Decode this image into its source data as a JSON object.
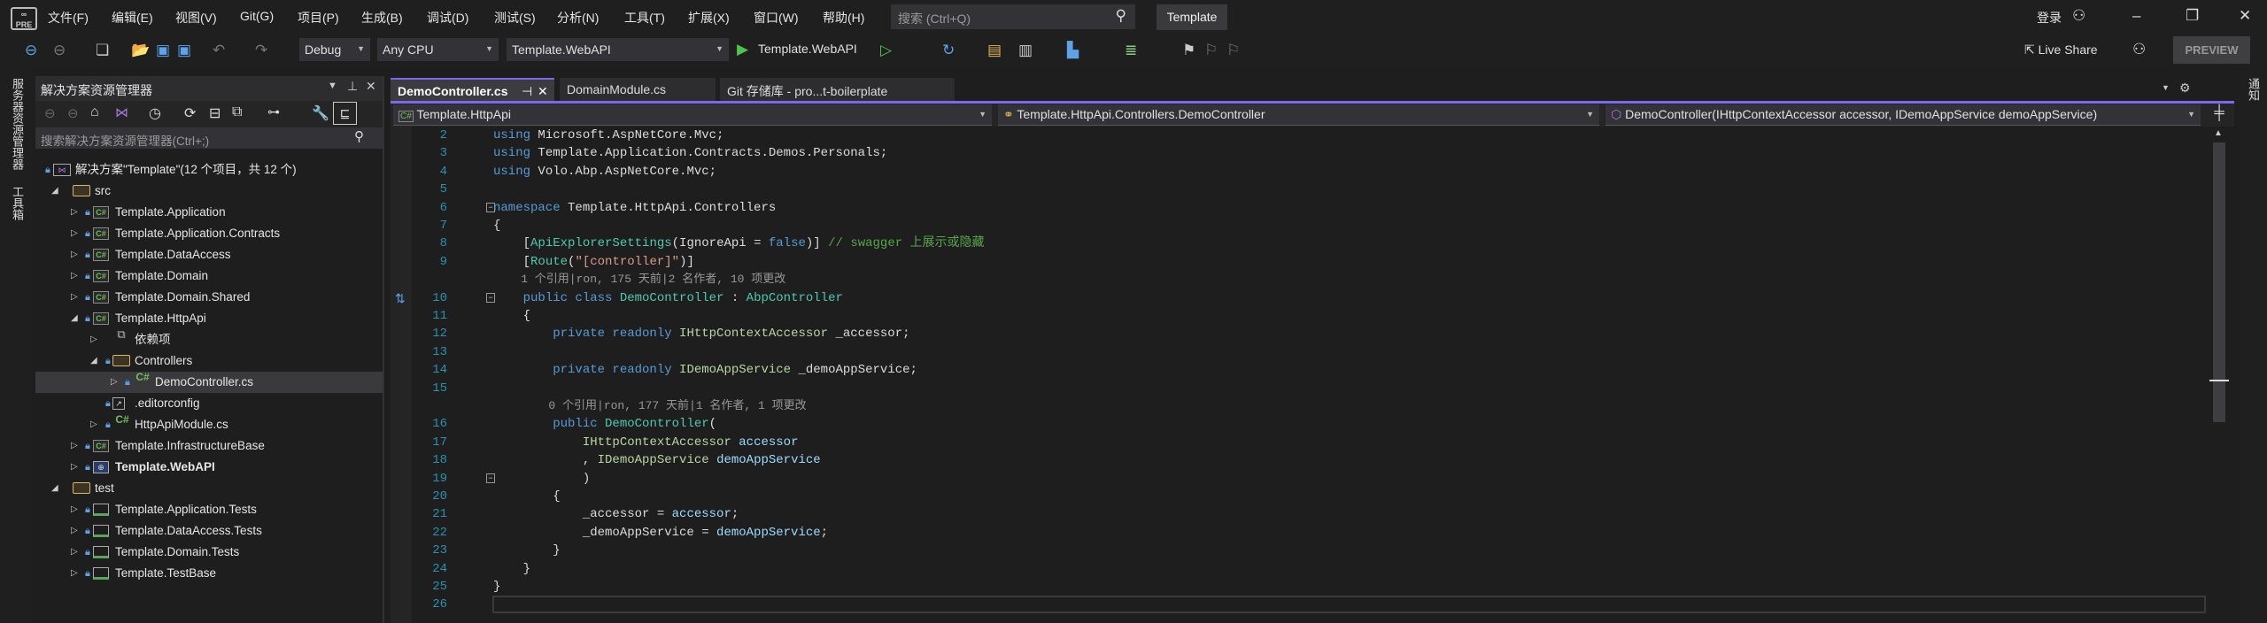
{
  "menu": {
    "logo_text": "PRE",
    "items": [
      "文件(F)",
      "编辑(E)",
      "视图(V)",
      "Git(G)",
      "项目(P)",
      "生成(B)",
      "调试(D)",
      "测试(S)",
      "分析(N)",
      "工具(T)",
      "扩展(X)",
      "窗口(W)",
      "帮助(H)"
    ],
    "search_placeholder": "搜索 (Ctrl+Q)",
    "title_badge": "Template",
    "signin": "登录"
  },
  "toolbar": {
    "config": "Debug",
    "platform": "Any CPU",
    "startup_project": "Template.WebAPI",
    "run_label": "Template.WebAPI",
    "live_share": "Live Share",
    "preview": "PREVIEW"
  },
  "left_strip": [
    "服务器资源管理器",
    "工具箱"
  ],
  "right_strip": [
    "通知"
  ],
  "solution_explorer": {
    "title": "解决方案资源管理器",
    "search_placeholder": "搜索解决方案资源管理器(Ctrl+;)",
    "items": [
      {
        "label": "解决方案\"Template\"(12 个项目，共 12 个)",
        "level": 0,
        "icon": "solution",
        "expander": "none",
        "lock": true
      },
      {
        "label": "src",
        "level": 1,
        "icon": "folder",
        "expander": "expanded",
        "lock": false
      },
      {
        "label": "Template.Application",
        "level": 2,
        "icon": "csproj",
        "expander": "collapsed",
        "lock": true
      },
      {
        "label": "Template.Application.Contracts",
        "level": 2,
        "icon": "csproj",
        "expander": "collapsed",
        "lock": true
      },
      {
        "label": "Template.DataAccess",
        "level": 2,
        "icon": "csproj",
        "expander": "collapsed",
        "lock": true
      },
      {
        "label": "Template.Domain",
        "level": 2,
        "icon": "csproj",
        "expander": "collapsed",
        "lock": true
      },
      {
        "label": "Template.Domain.Shared",
        "level": 2,
        "icon": "csproj",
        "expander": "collapsed",
        "lock": true
      },
      {
        "label": "Template.HttpApi",
        "level": 2,
        "icon": "csproj",
        "expander": "expanded",
        "lock": true
      },
      {
        "label": "依赖项",
        "level": 3,
        "icon": "dependencies",
        "expander": "collapsed",
        "lock": false
      },
      {
        "label": "Controllers",
        "level": 3,
        "icon": "folder",
        "expander": "expanded",
        "lock": true
      },
      {
        "label": "DemoController.cs",
        "level": 4,
        "icon": "csfile",
        "expander": "collapsed",
        "lock": true,
        "selected": true
      },
      {
        "label": ".editorconfig",
        "level": 3,
        "icon": "file",
        "expander": "none",
        "lock": true
      },
      {
        "label": "HttpApiModule.cs",
        "level": 3,
        "icon": "csfile",
        "expander": "collapsed",
        "lock": true
      },
      {
        "label": "Template.InfrastructureBase",
        "level": 2,
        "icon": "csproj",
        "expander": "collapsed",
        "lock": true
      },
      {
        "label": "Template.WebAPI",
        "level": 2,
        "icon": "webproj",
        "expander": "collapsed",
        "lock": true,
        "bold": true
      },
      {
        "label": "test",
        "level": 1,
        "icon": "folder",
        "expander": "expanded",
        "lock": false
      },
      {
        "label": "Template.Application.Tests",
        "level": 2,
        "icon": "testproj",
        "expander": "collapsed",
        "lock": true
      },
      {
        "label": "Template.DataAccess.Tests",
        "level": 2,
        "icon": "testproj",
        "expander": "collapsed",
        "lock": true
      },
      {
        "label": "Template.Domain.Tests",
        "level": 2,
        "icon": "testproj",
        "expander": "collapsed",
        "lock": true
      },
      {
        "label": "Template.TestBase",
        "level": 2,
        "icon": "testproj",
        "expander": "collapsed",
        "lock": true
      }
    ]
  },
  "editor": {
    "tabs": [
      {
        "label": "DemoController.cs",
        "active": true
      },
      {
        "label": "DomainModule.cs",
        "active": false
      },
      {
        "label": "Git 存储库 - pro...t-boilerplate",
        "active": false
      }
    ],
    "nav": {
      "project": "Template.HttpApi",
      "type": "Template.HttpApi.Controllers.DemoController",
      "member": "DemoController(IHttpContextAccessor accessor, IDemoAppService demoAppService)"
    },
    "lines": [
      {
        "n": "2",
        "tokens": [
          {
            "t": "using",
            "c": "kw"
          },
          {
            "t": " Microsoft.AspNetCore.Mvc;",
            "c": "tx"
          }
        ]
      },
      {
        "n": "3",
        "tokens": [
          {
            "t": "using",
            "c": "kw"
          },
          {
            "t": " Template.Application.Contracts.Demos.Personals;",
            "c": "tx"
          }
        ]
      },
      {
        "n": "4",
        "tokens": [
          {
            "t": "using",
            "c": "kw"
          },
          {
            "t": " Volo.Abp.AspNetCore.Mvc;",
            "c": "tx"
          }
        ]
      },
      {
        "n": "5",
        "tokens": []
      },
      {
        "n": "6",
        "fold": true,
        "tokens": [
          {
            "t": "namespace",
            "c": "kw"
          },
          {
            "t": " Template.HttpApi.Controllers",
            "c": "tx"
          }
        ]
      },
      {
        "n": "7",
        "tokens": [
          {
            "t": "{",
            "c": "tx"
          }
        ]
      },
      {
        "n": "8",
        "tokens": [
          {
            "t": "    [",
            "c": "tx"
          },
          {
            "t": "ApiExplorerSettings",
            "c": "ty"
          },
          {
            "t": "(IgnoreApi = ",
            "c": "tx"
          },
          {
            "t": "false",
            "c": "kw"
          },
          {
            "t": ")] ",
            "c": "tx"
          },
          {
            "t": "// swagger 上展示或隐藏",
            "c": "cm"
          }
        ]
      },
      {
        "n": "9",
        "tokens": [
          {
            "t": "    [",
            "c": "tx"
          },
          {
            "t": "Route",
            "c": "ty"
          },
          {
            "t": "(",
            "c": "tx"
          },
          {
            "t": "\"[controller]\"",
            "c": "st"
          },
          {
            "t": ")]",
            "c": "tx"
          }
        ]
      },
      {
        "lens": "    1 个引用|ron, 175 天前|2 名作者, 10 项更改"
      },
      {
        "n": "10",
        "fold": true,
        "tokens": [
          {
            "t": "    ",
            "c": "tx"
          },
          {
            "t": "public class ",
            "c": "kw"
          },
          {
            "t": "DemoController",
            "c": "ty"
          },
          {
            "t": " : ",
            "c": "tx"
          },
          {
            "t": "AbpController",
            "c": "ty"
          }
        ]
      },
      {
        "n": "11",
        "tokens": [
          {
            "t": "    {",
            "c": "tx"
          }
        ]
      },
      {
        "n": "12",
        "tokens": [
          {
            "t": "        ",
            "c": "tx"
          },
          {
            "t": "private readonly ",
            "c": "kw"
          },
          {
            "t": "IHttpContextAccessor",
            "c": "if"
          },
          {
            "t": " _accessor;",
            "c": "tx"
          }
        ]
      },
      {
        "n": "13",
        "tokens": []
      },
      {
        "n": "14",
        "tokens": [
          {
            "t": "        ",
            "c": "tx"
          },
          {
            "t": "private readonly ",
            "c": "kw"
          },
          {
            "t": "IDemoAppService",
            "c": "if"
          },
          {
            "t": " _demoAppService;",
            "c": "tx"
          }
        ]
      },
      {
        "n": "15",
        "tokens": []
      },
      {
        "lens": "        0 个引用|ron, 177 天前|1 名作者, 1 项更改"
      },
      {
        "n": "16",
        "tokens": [
          {
            "t": "        ",
            "c": "tx"
          },
          {
            "t": "public ",
            "c": "kw"
          },
          {
            "t": "DemoController",
            "c": "ty"
          },
          {
            "t": "(",
            "c": "tx"
          }
        ]
      },
      {
        "n": "17",
        "tokens": [
          {
            "t": "            ",
            "c": "tx"
          },
          {
            "t": "IHttpContextAccessor",
            "c": "if"
          },
          {
            "t": " ",
            "c": "tx"
          },
          {
            "t": "accessor",
            "c": "pa"
          }
        ]
      },
      {
        "n": "18",
        "tokens": [
          {
            "t": "            , ",
            "c": "tx"
          },
          {
            "t": "IDemoAppService",
            "c": "if"
          },
          {
            "t": " ",
            "c": "tx"
          },
          {
            "t": "demoAppService",
            "c": "pa"
          }
        ]
      },
      {
        "n": "19",
        "fold": true,
        "tokens": [
          {
            "t": "            )",
            "c": "tx"
          }
        ]
      },
      {
        "n": "20",
        "tokens": [
          {
            "t": "        {",
            "c": "tx"
          }
        ]
      },
      {
        "n": "21",
        "tokens": [
          {
            "t": "            _accessor = ",
            "c": "tx"
          },
          {
            "t": "accessor",
            "c": "pa"
          },
          {
            "t": ";",
            "c": "tx"
          }
        ]
      },
      {
        "n": "22",
        "tokens": [
          {
            "t": "            _demoAppService = ",
            "c": "tx"
          },
          {
            "t": "demoAppService",
            "c": "pa"
          },
          {
            "t": ";",
            "c": "tx"
          }
        ]
      },
      {
        "n": "23",
        "tokens": [
          {
            "t": "        }",
            "c": "tx"
          }
        ]
      },
      {
        "n": "24",
        "tokens": [
          {
            "t": "    }",
            "c": "tx"
          }
        ]
      },
      {
        "n": "25",
        "tokens": [
          {
            "t": "}",
            "c": "tx"
          }
        ]
      },
      {
        "n": "26",
        "tokens": []
      }
    ]
  },
  "colors": {
    "accent": "#7b68ee",
    "keyword": "#569cd6",
    "type": "#4ec9b0",
    "interface": "#b8d7a3",
    "comment": "#57a64a",
    "string": "#d69d85",
    "parameter": "#9cdcfe",
    "line_number": "#2b91af"
  }
}
